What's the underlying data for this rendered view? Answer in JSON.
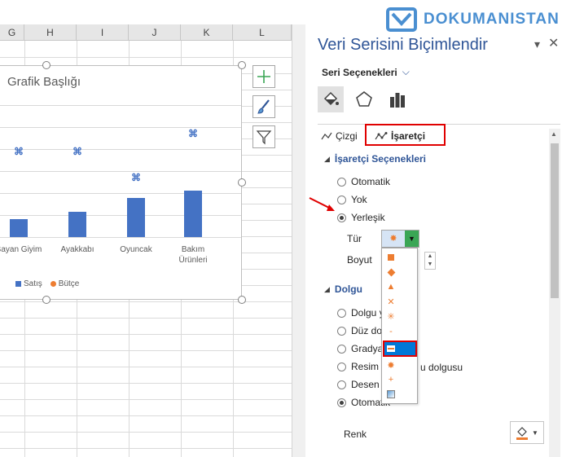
{
  "columns": [
    "G",
    "H",
    "I",
    "J",
    "K",
    "L"
  ],
  "chart": {
    "title": "Grafik Başlığı",
    "categories": [
      "Bayan Giyim",
      "Ayakkabı",
      "Oyuncak",
      "Bakım\nÜrünleri"
    ],
    "legend": [
      {
        "label": "Satış",
        "color": "#4472c4"
      },
      {
        "label": "Bütçe",
        "color": "#ed7d31"
      }
    ]
  },
  "chart_data": {
    "type": "bar",
    "categories": [
      "Bayan Giyim",
      "Ayakkabı",
      "Oyuncak",
      "Bakım Ürünleri"
    ],
    "series": [
      {
        "name": "Satış",
        "type": "bar",
        "values": [
          1.5,
          2.1,
          3.2,
          3.8
        ]
      },
      {
        "name": "Bütçe",
        "type": "line-markers",
        "values": [
          7.0,
          7.0,
          4.9,
          8.5
        ]
      }
    ],
    "title": "Grafik Başlığı",
    "legend": "bottom"
  },
  "side_buttons": [
    "plus-icon",
    "brush-icon",
    "filter-icon"
  ],
  "pane": {
    "title": "Veri Serisini Biçimlendir",
    "series_options": "Seri Seçenekleri",
    "tabs": [
      "Çizgi",
      "İşaretçi"
    ],
    "marker_section": "İşaretçi Seçenekleri",
    "marker_options": [
      "Otomatik",
      "Yok",
      "Yerleşik"
    ],
    "selected_marker_option": "Yerleşik",
    "type_label": "Tür",
    "size_label": "Boyut",
    "fill_section": "Dolgu",
    "fill_options": [
      "Dolgu y",
      "Düz dol",
      "Gradya",
      "Resim y",
      "u dolgusu",
      "Desen d",
      "Otomatik"
    ],
    "color_label": "Renk"
  },
  "logo_text": "DOKUMANISTAN",
  "accent": "#2f5597",
  "highlight": "#e00000"
}
